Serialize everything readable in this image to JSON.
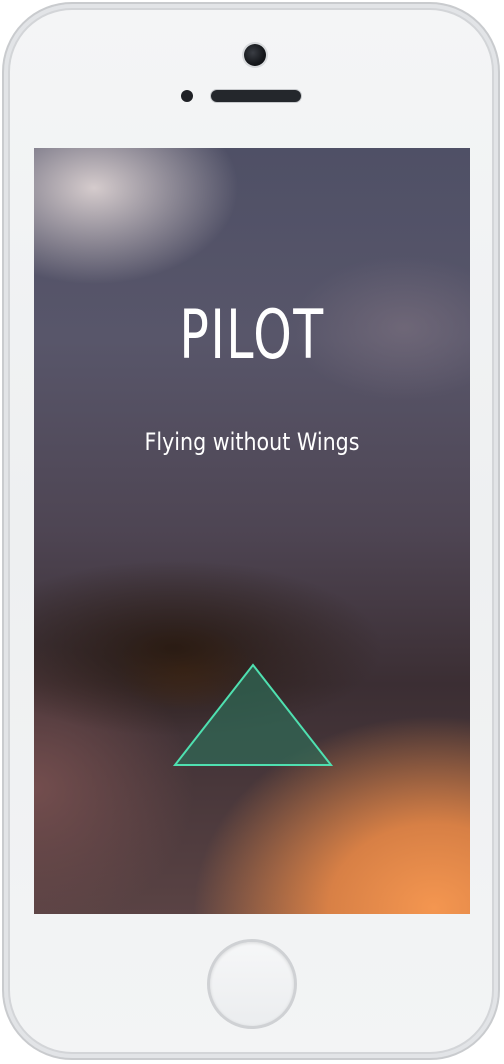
{
  "app": {
    "title": "PILOT",
    "tagline": "Flying without Wings"
  },
  "play_button": {
    "icon": "triangle-icon",
    "fill_color": "#2f6b57",
    "stroke_color": "#4fe0b0"
  },
  "device": {
    "home_button_icon": "home-button"
  },
  "colors": {
    "title_text": "#ffffff",
    "bg_top": "#4f5066",
    "bg_bottom_accent": "#f49650"
  }
}
